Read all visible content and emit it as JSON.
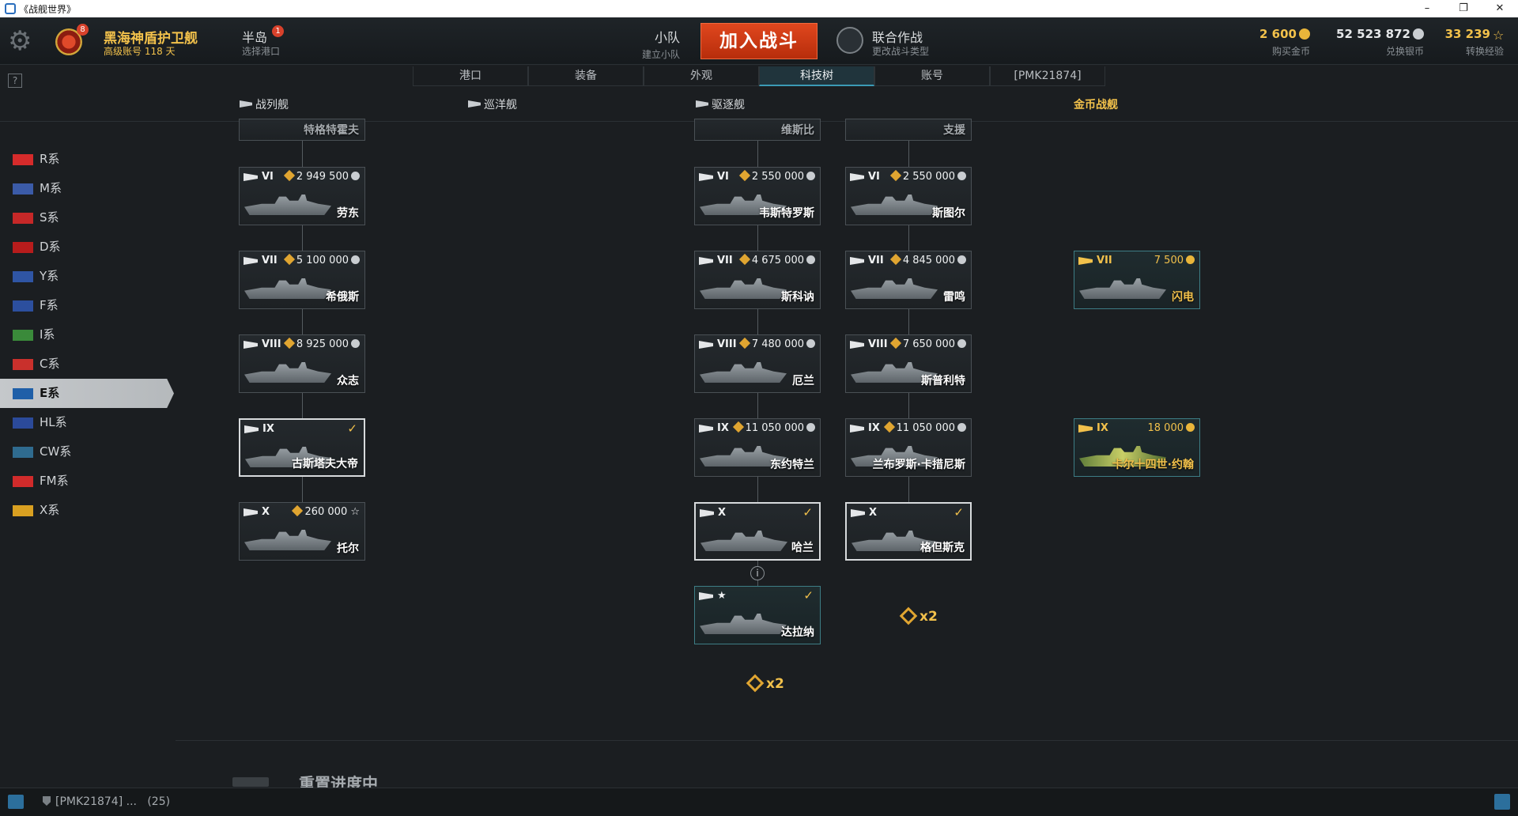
{
  "window": {
    "title": "《战舰世界》",
    "controls": [
      "–",
      "❐",
      "✕"
    ]
  },
  "header": {
    "player_name": "黑海神盾护卫舰",
    "player_sub": "高级账号 118 天",
    "player_badge": "8",
    "port_name": "半岛",
    "port_badge": "1",
    "port_sub": "选择港口",
    "squad_title": "小队",
    "squad_sub": "建立小队",
    "battle_button": "加入战斗",
    "mode_name": "联合作战",
    "mode_sub": "更改战斗类型",
    "currencies": [
      {
        "value": "2 600",
        "label": "购买金币",
        "color": "#f2c14b"
      },
      {
        "value": "52 523 872",
        "label": "兑换银币",
        "color": "#e6e8ea"
      },
      {
        "value": "33 239",
        "label": "转换经验",
        "color": "#f2c14b"
      }
    ]
  },
  "help": "?",
  "tabs": [
    "港口",
    "装备",
    "外观",
    "科技树",
    "账号",
    "[PMK21874]"
  ],
  "active_tab": "科技树",
  "classes": {
    "battleship": "战列舰",
    "cruiser": "巡洋舰",
    "destroyer": "驱逐舰",
    "premium": "金币战舰"
  },
  "nations": [
    {
      "label": "R系",
      "flag": "#d62b2b"
    },
    {
      "label": "M系",
      "flag": "#3b5ba8"
    },
    {
      "label": "S系",
      "flag": "#c62828"
    },
    {
      "label": "D系",
      "flag": "#b71c1c"
    },
    {
      "label": "Y系",
      "flag": "#2f55a4"
    },
    {
      "label": "F系",
      "flag": "#2c4f9e"
    },
    {
      "label": "I系",
      "flag": "#3a8a3a"
    },
    {
      "label": "C系",
      "flag": "#c9302c"
    },
    {
      "label": "E系",
      "flag": "#1f5fa8"
    },
    {
      "label": "HL系",
      "flag": "#2b4a9a"
    },
    {
      "label": "CW系",
      "flag": "#2f6b8f"
    },
    {
      "label": "FM系",
      "flag": "#d12b2b"
    },
    {
      "label": "X系",
      "flag": "#d9a021"
    }
  ],
  "active_nation": "E系",
  "ships": {
    "bb_top": {
      "name": "特格特霍夫"
    },
    "bb6": {
      "tier": "VI",
      "price": "2 949 500",
      "name": "劳东"
    },
    "bb7": {
      "tier": "VII",
      "price": "5 100 000",
      "name": "希俄斯"
    },
    "bb8": {
      "tier": "VIII",
      "price": "8 925 000",
      "name": "众志"
    },
    "bb9": {
      "tier": "IX",
      "price": "✓",
      "name": "古斯塔夫大帝"
    },
    "bb10": {
      "tier": "X",
      "price": "260 000 ☆",
      "name": "托尔"
    },
    "dd_a_top": {
      "name": "维斯比"
    },
    "dd_a6": {
      "tier": "VI",
      "price": "2 550 000",
      "name": "韦斯特罗斯"
    },
    "dd_a7": {
      "tier": "VII",
      "price": "4 675 000",
      "name": "斯科讷"
    },
    "dd_a8": {
      "tier": "VIII",
      "price": "7 480 000",
      "name": "厄兰"
    },
    "dd_a9": {
      "tier": "IX",
      "price": "11 050 000",
      "name": "东约特兰"
    },
    "dd_a10": {
      "tier": "X",
      "price": "✓",
      "name": "哈兰"
    },
    "dd_a_star": {
      "tier": "★",
      "price": "✓",
      "name": "达拉纳"
    },
    "dd_b_top": {
      "name": "支援"
    },
    "dd_b6": {
      "tier": "VI",
      "price": "2 550 000",
      "name": "斯图尔"
    },
    "dd_b7": {
      "tier": "VII",
      "price": "4 845 000",
      "name": "雷鸣"
    },
    "dd_b8": {
      "tier": "VIII",
      "price": "7 650 000",
      "name": "斯普利特"
    },
    "dd_b9": {
      "tier": "IX",
      "price": "11 050 000",
      "name": "兰布罗斯·卡措尼斯"
    },
    "dd_b10": {
      "tier": "X",
      "price": "✓",
      "name": "格但斯克"
    },
    "prem7": {
      "tier": "VII",
      "price": "7 500",
      "name": "闪电"
    },
    "prem9": {
      "tier": "IX",
      "price": "18 000",
      "name": "卡尔十四世·约翰"
    }
  },
  "info_dot": "i",
  "bonus": [
    "x2",
    "x2"
  ],
  "reset_title": "重置进度中",
  "status": {
    "clan": "[PMK21874] ...",
    "count": "(25)"
  }
}
